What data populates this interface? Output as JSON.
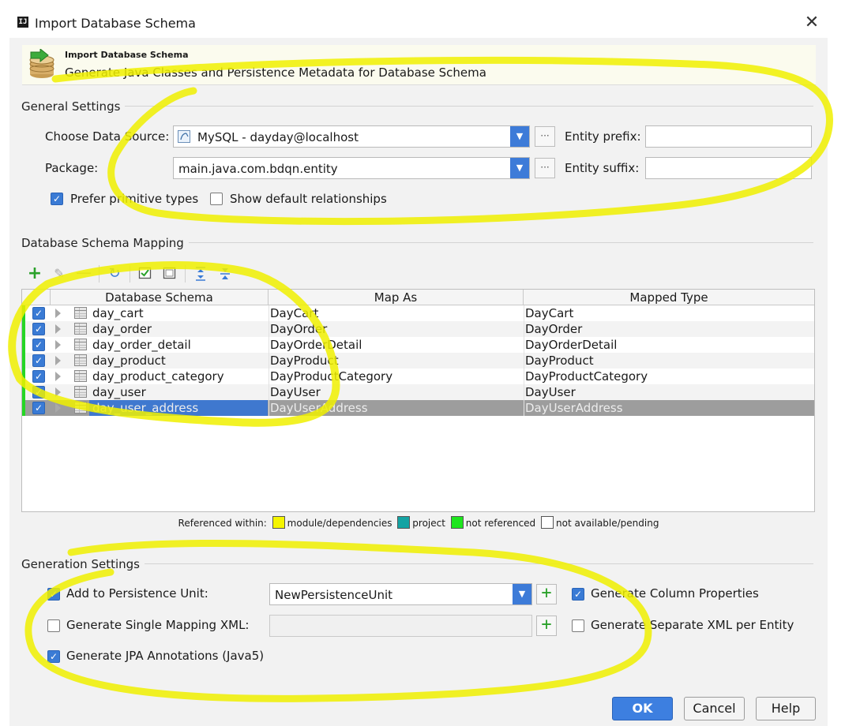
{
  "window": {
    "title": "Import Database Schema",
    "app_icon": "IJ"
  },
  "banner": {
    "title": "Import Database Schema",
    "subtitle": "Generate Java Classes and Persistence Metadata for Database Schema"
  },
  "general": {
    "section_title": "General Settings",
    "datasource_label": "Choose Data Source:",
    "datasource_value": "MySQL - dayday@localhost",
    "package_label": "Package:",
    "package_value": "main.java.com.bdqn.entity",
    "entity_prefix_label": "Entity prefix:",
    "entity_prefix_value": "",
    "entity_suffix_label": "Entity suffix:",
    "entity_suffix_value": "",
    "prefer_primitive_label": "Prefer primitive types",
    "prefer_primitive_checked": true,
    "show_default_rel_label": "Show default relationships",
    "show_default_rel_checked": false
  },
  "mapping": {
    "section_title": "Database Schema Mapping",
    "columns": [
      "Database Schema",
      "Map As",
      "Mapped Type"
    ],
    "rows": [
      {
        "schema": "day_cart",
        "map_as": "DayCart",
        "type": "DayCart",
        "checked": true
      },
      {
        "schema": "day_order",
        "map_as": "DayOrder",
        "type": "DayOrder",
        "checked": true
      },
      {
        "schema": "day_order_detail",
        "map_as": "DayOrderDetail",
        "type": "DayOrderDetail",
        "checked": true
      },
      {
        "schema": "day_product",
        "map_as": "DayProduct",
        "type": "DayProduct",
        "checked": true
      },
      {
        "schema": "day_product_category",
        "map_as": "DayProductCategory",
        "type": "DayProductCategory",
        "checked": true
      },
      {
        "schema": "day_user",
        "map_as": "DayUser",
        "type": "DayUser",
        "checked": true
      },
      {
        "schema": "day_user_address",
        "map_as": "DayUserAddress",
        "type": "DayUserAddress",
        "checked": true,
        "selected": true
      }
    ],
    "legend": {
      "prefix": "Referenced within:",
      "items": [
        {
          "label": "module/dependencies",
          "color": "#f5f500"
        },
        {
          "label": "project",
          "color": "#14a3a3"
        },
        {
          "label": "not referenced",
          "color": "#1ee61e"
        },
        {
          "label": "not available/pending",
          "color": "#ffffff"
        }
      ]
    }
  },
  "generation": {
    "section_title": "Generation Settings",
    "persistence_unit_label": "Add to Persistence Unit:",
    "persistence_unit_checked": true,
    "persistence_unit_value": "NewPersistenceUnit",
    "single_xml_label": "Generate Single Mapping XML:",
    "single_xml_checked": false,
    "single_xml_value": "",
    "jpa_annotations_label": "Generate JPA Annotations (Java5)",
    "jpa_annotations_checked": true,
    "column_props_label": "Generate Column Properties",
    "column_props_checked": true,
    "separate_xml_label": "Generate Separate XML per Entity",
    "separate_xml_checked": false
  },
  "buttons": {
    "ok": "OK",
    "cancel": "Cancel",
    "help": "Help"
  },
  "colors": {
    "accent": "#3d7fe0",
    "highlight_marker": "#f0f000",
    "selection": "#3f78cf"
  }
}
